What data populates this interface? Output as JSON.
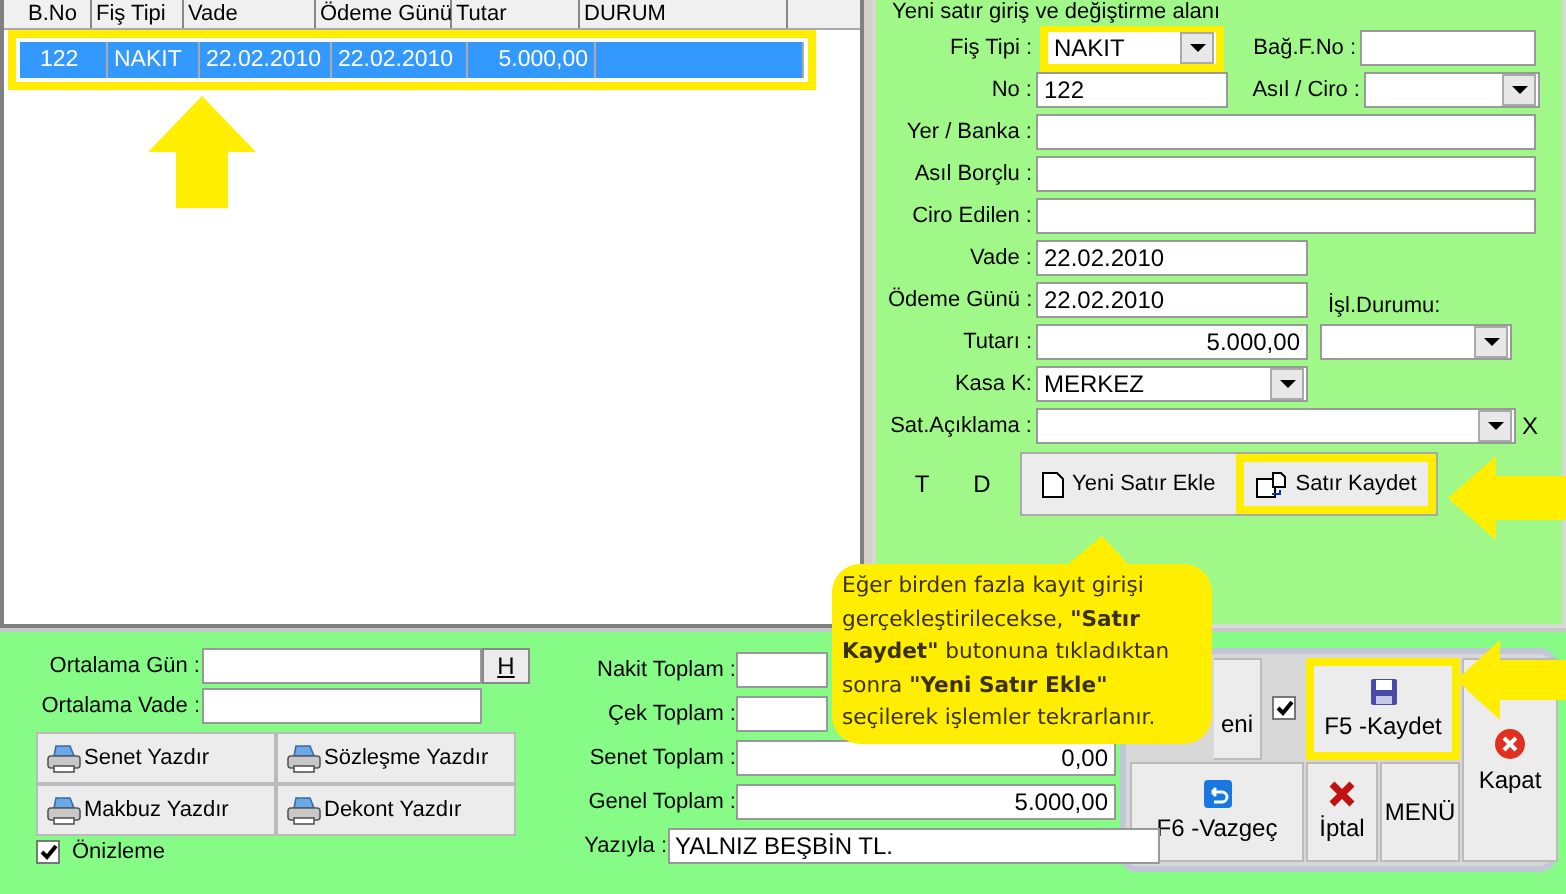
{
  "grid": {
    "columns": [
      "B.No",
      "Fiş Tipi",
      "Vade",
      "Ödeme Günü",
      "Tutar",
      "DURUM"
    ],
    "rows": [
      {
        "cells": [
          "122",
          "NAKIT",
          "22.02.2010",
          "22.02.2010",
          "5.000,00",
          ""
        ],
        "selected": true,
        "highlighted": true
      }
    ]
  },
  "entry": {
    "title": "Yeni satır giriş ve değiştirme alanı",
    "fis_tipi": {
      "label": "Fiş Tipi :",
      "value": "NAKIT",
      "highlighted": true
    },
    "bag_f_no": {
      "label": "Bağ.F.No :"
    },
    "no": {
      "label": "No :",
      "value": "122"
    },
    "asil_ciro": {
      "label": "Asıl / Ciro :"
    },
    "yer_banka": {
      "label": "Yer / Banka :"
    },
    "asil_borclu": {
      "label": "Asıl Borçlu :"
    },
    "ciro_edilen": {
      "label": "Ciro Edilen :"
    },
    "vade": {
      "label": "Vade :",
      "value": "22.02.2010"
    },
    "odeme_gunu": {
      "label": "Ödeme Günü :",
      "value": "22.02.2010"
    },
    "isl_durumu": {
      "label": "İşl.Durumu:"
    },
    "tutari": {
      "label": "Tutarı :",
      "value": "5.000,00"
    },
    "kasa_k": {
      "label": "Kasa K:",
      "value": "MERKEZ"
    },
    "sat_aciklama": {
      "label": "Sat.Açıklama :",
      "clear": "X"
    },
    "markers": [
      "T",
      "D"
    ],
    "buttons": [
      {
        "kind": "new",
        "label": "Yeni Satır Ekle",
        "highlighted": false
      },
      {
        "kind": "save",
        "label": "Satır Kaydet",
        "highlighted": true
      }
    ]
  },
  "averages": {
    "gun_label": "Ortalama Gün  :",
    "h_button": "H",
    "vade_label": "Ortalama Vade :"
  },
  "print_buttons": [
    "Senet Yazdır",
    "Sözleşme Yazdır",
    "Makbuz Yazdır",
    "Dekont Yazdır"
  ],
  "preview": {
    "label": "Önizleme",
    "checked": true
  },
  "totals": [
    {
      "label": "Nakit Toplam :"
    },
    {
      "label": "Çek Toplam :"
    },
    {
      "label": "Senet Toplam :",
      "value": "0,00"
    },
    {
      "label": "Genel Toplam :",
      "value": "5.000,00"
    }
  ],
  "yaziyla": {
    "label": "Yazıyla :",
    "value": "YALNIZ BEŞBİN TL."
  },
  "actions": {
    "new_label": "eni",
    "auto_checked": true,
    "save": {
      "label": "F5 -Kaydet",
      "highlighted": true
    },
    "close": "Kapat",
    "cancel": "F6 -Vazgeç",
    "void": "İptal",
    "menu": "MENÜ"
  },
  "callout": "Eğer birden fazla kayıt girişi gerçekleştirilecekse, **\"Satır Kaydet\"** butonuna tıkladıktan sonra **\"Yeni Satır Ekle\"** seçilerek işlemler tekrarlanır."
}
